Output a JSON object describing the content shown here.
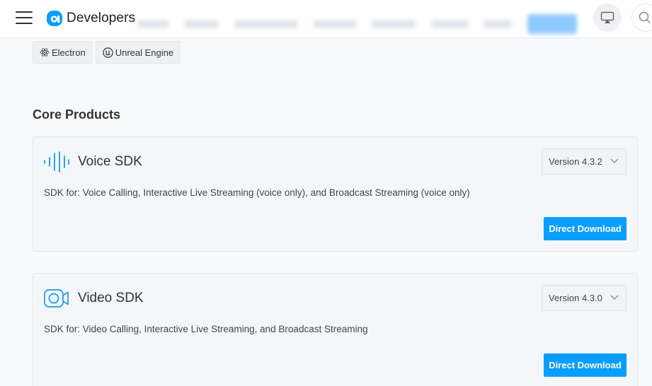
{
  "header": {
    "logo_text": "Developers"
  },
  "platforms": [
    {
      "label": "Electron",
      "icon": "electron-icon"
    },
    {
      "label": "Unreal Engine",
      "icon": "unreal-engine-icon"
    }
  ],
  "section": {
    "title": "Core Products"
  },
  "products": [
    {
      "title": "Voice SDK",
      "icon": "voice-wave-icon",
      "version": "Version 4.3.2",
      "description": "SDK for: Voice Calling, Interactive Live Streaming (voice only), and Broadcast Streaming (voice only)",
      "download_label": "Direct Download"
    },
    {
      "title": "Video SDK",
      "icon": "video-camera-icon",
      "version": "Version 4.3.0",
      "description": "SDK for: Video Calling, Interactive Live Streaming, and Broadcast Streaming",
      "download_label": "Direct Download"
    }
  ],
  "colors": {
    "accent": "#099dfd",
    "icon_blue": "#1a9ce8",
    "card_bg": "#f4f7fa"
  }
}
